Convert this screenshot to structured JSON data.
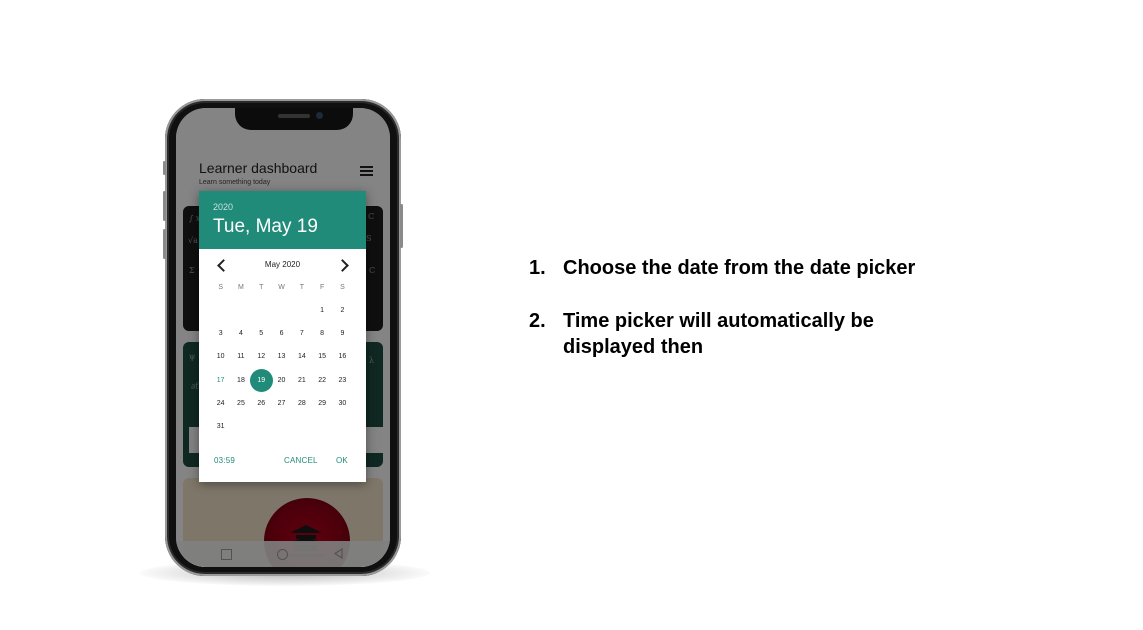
{
  "app": {
    "title": "Learner dashboard",
    "subtitle": "Learn something today"
  },
  "date_picker": {
    "year": "2020",
    "selected_date": "Tue, May 19",
    "month_label": "May 2020",
    "weekdays": [
      "S",
      "M",
      "T",
      "W",
      "T",
      "F",
      "S"
    ],
    "weeks": [
      [
        "",
        "",
        "",
        "",
        "",
        "1",
        "2"
      ],
      [
        "3",
        "4",
        "5",
        "6",
        "7",
        "8",
        "9"
      ],
      [
        "10",
        "11",
        "12",
        "13",
        "14",
        "15",
        "16"
      ],
      [
        "17",
        "18",
        "19",
        "20",
        "21",
        "22",
        "23"
      ],
      [
        "24",
        "25",
        "26",
        "27",
        "28",
        "29",
        "30"
      ],
      [
        "31",
        "",
        "",
        "",
        "",
        "",
        ""
      ]
    ],
    "today": "17",
    "selected_day": "19",
    "time": "03:59",
    "cancel_label": "CANCEL",
    "ok_label": "OK",
    "accent_color": "#218b79"
  },
  "instructions": [
    {
      "number": "1.",
      "text": "Choose the date from the date picker"
    },
    {
      "number": "2.",
      "text": "Time picker will automatically be displayed then"
    }
  ]
}
